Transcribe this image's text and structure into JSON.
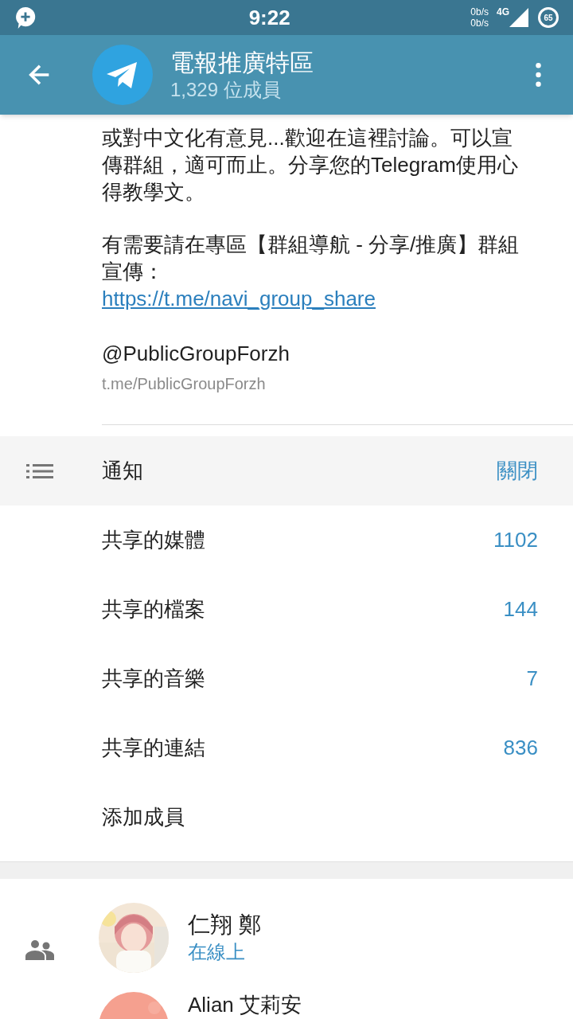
{
  "status_bar": {
    "time": "9:22",
    "net_up": "0b/s",
    "net_down": "0b/s",
    "network": "4G",
    "battery": "65"
  },
  "header": {
    "title": "電報推廣特區",
    "subtitle": "1,329 位成員"
  },
  "description": {
    "paragraphs": [
      "或對中文化有意見...歡迎在這裡討論。可以宣傳群組，適可而止。分享您的Telegram使用心得教學文。",
      "有需要請在專區【群組導航 - 分享/推廣】群組宣傳："
    ],
    "link": "https://t.me/navi_group_share",
    "username": "@PublicGroupForzh",
    "username_link": "t.me/PublicGroupForzh"
  },
  "settings": [
    {
      "kind": "toggle",
      "label": "通知",
      "value": "關閉"
    },
    {
      "kind": "count",
      "label": "共享的媒體",
      "value": "1102"
    },
    {
      "kind": "count",
      "label": "共享的檔案",
      "value": "144"
    },
    {
      "kind": "count",
      "label": "共享的音樂",
      "value": "7"
    },
    {
      "kind": "count",
      "label": "共享的連結",
      "value": "836"
    },
    {
      "kind": "action",
      "label": "添加成員"
    }
  ],
  "members": [
    {
      "name": "仁翔 鄭",
      "status": "在線上"
    },
    {
      "name": "Alian 艾莉安"
    }
  ]
}
